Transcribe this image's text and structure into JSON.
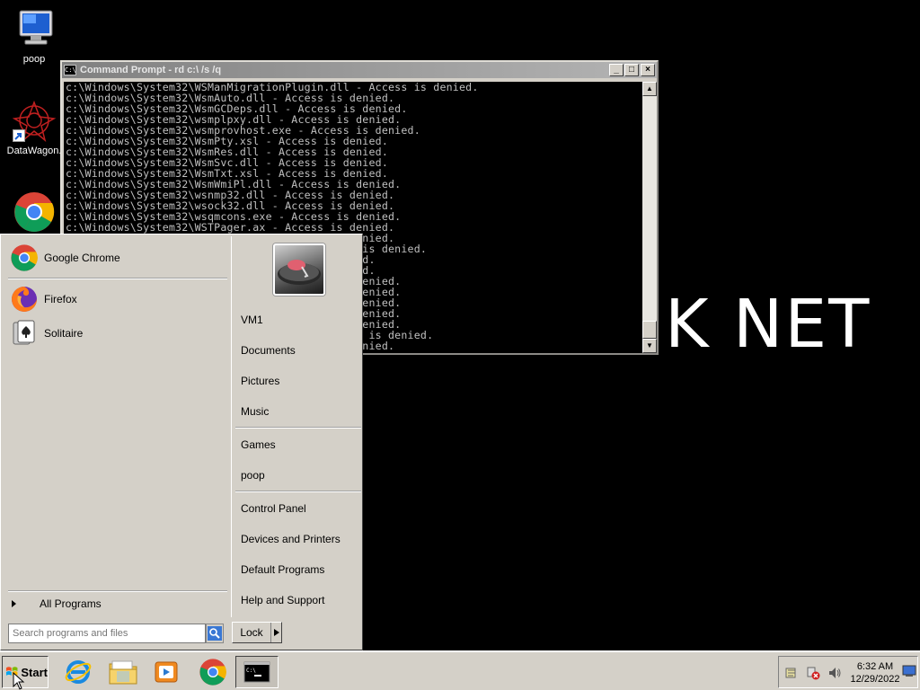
{
  "desktop": {
    "icons": [
      {
        "label": "poop",
        "icon": "computer-icon"
      },
      {
        "label": "DataWagon.",
        "icon": "datawagon-icon"
      },
      {
        "label": "",
        "icon": "chrome-icon"
      }
    ],
    "wallpaper_text": "K NET"
  },
  "cmd_window": {
    "title": "Command Prompt - rd  c:\\ /s /q",
    "icon_text": "C:\\",
    "lines": [
      "c:\\Windows\\System32\\WSManMigrationPlugin.dll - Access is denied.",
      "c:\\Windows\\System32\\WsmAuto.dll - Access is denied.",
      "c:\\Windows\\System32\\WsmGCDeps.dll - Access is denied.",
      "c:\\Windows\\System32\\wsmplpxy.dll - Access is denied.",
      "c:\\Windows\\System32\\wsmprovhost.exe - Access is denied.",
      "c:\\Windows\\System32\\WsmPty.xsl - Access is denied.",
      "c:\\Windows\\System32\\WsmRes.dll - Access is denied.",
      "c:\\Windows\\System32\\WsmSvc.dll - Access is denied.",
      "c:\\Windows\\System32\\WsmTxt.xsl - Access is denied.",
      "c:\\Windows\\System32\\WsmWmiPl.dll - Access is denied.",
      "c:\\Windows\\System32\\wsnmp32.dll - Access is denied.",
      "c:\\Windows\\System32\\wsock32.dll - Access is denied.",
      "c:\\Windows\\System32\\wsqmcons.exe - Access is denied.",
      "c:\\Windows\\System32\\WSTPager.ax - Access is denied.",
      "                                         is denied.",
      "                                        ccess is denied.",
      "                                         denied.",
      "                                         denied.",
      "                                        s is denied.",
      "                                        s is denied.",
      "                                        s is denied.",
      "                                        s is denied.",
      "                                        s is denied.",
      "                                        Access is denied.",
      "                                         is denied."
    ]
  },
  "start_menu": {
    "pinned": [
      {
        "label": "Google Chrome",
        "icon": "chrome-icon"
      }
    ],
    "recent": [
      {
        "label": "Firefox",
        "icon": "firefox-icon"
      },
      {
        "label": "Solitaire",
        "icon": "solitaire-icon"
      }
    ],
    "all_programs": "All Programs",
    "search_placeholder": "Search programs and files",
    "right_items_group1": [
      "VM1",
      "Documents",
      "Pictures",
      "Music"
    ],
    "right_items_group2": [
      "Games",
      "poop"
    ],
    "right_items_group3": [
      "Control Panel",
      "Devices and Printers",
      "Default Programs",
      "Help and Support"
    ],
    "lock_label": "Lock"
  },
  "taskbar": {
    "start_label": "Start",
    "apps": [
      "internet-explorer-icon",
      "windows-explorer-icon",
      "media-player-icon",
      "chrome-icon",
      "command-prompt-icon"
    ],
    "time": "6:32 AM",
    "date": "12/29/2022"
  }
}
